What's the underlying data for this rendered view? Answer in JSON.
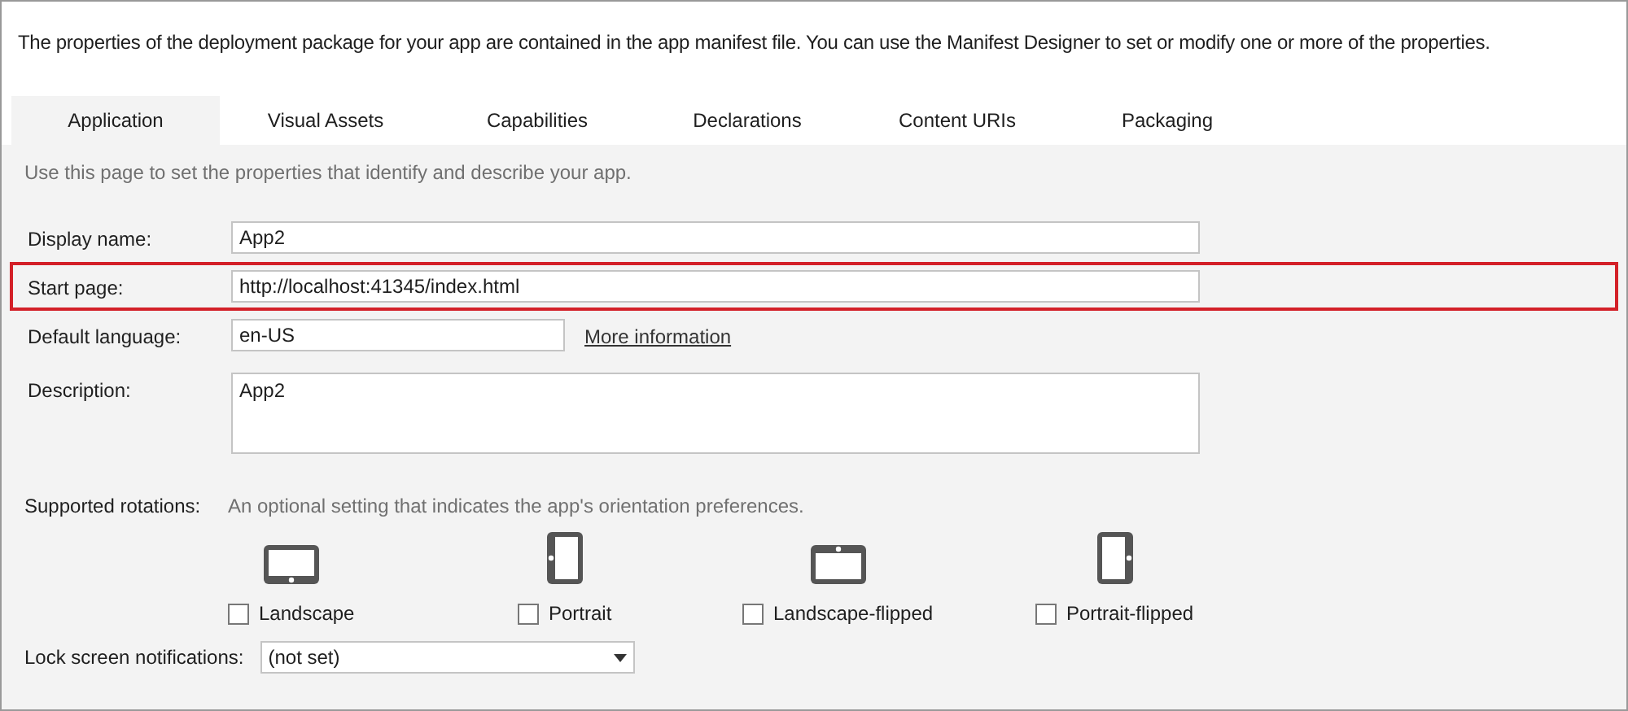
{
  "intro": "The properties of the deployment package for your app are contained in the app manifest file. You can use the Manifest Designer to set or modify one or more of the properties.",
  "tabs": [
    {
      "label": "Application",
      "selected": true
    },
    {
      "label": "Visual Assets",
      "selected": false
    },
    {
      "label": "Capabilities",
      "selected": false
    },
    {
      "label": "Declarations",
      "selected": false
    },
    {
      "label": "Content URIs",
      "selected": false
    },
    {
      "label": "Packaging",
      "selected": false
    }
  ],
  "page_hint": "Use this page to set the properties that identify and describe your app.",
  "fields": [
    {
      "kind": "text",
      "label": "Display name:",
      "value": "App2",
      "highlighted": false
    },
    {
      "kind": "text",
      "label": "Start page:",
      "value": "http://localhost:41345/index.html",
      "highlighted": true
    },
    {
      "kind": "short",
      "label": "Default language:",
      "value": "en-US",
      "link": "More information",
      "highlighted": false
    },
    {
      "kind": "multiline",
      "label": "Description:",
      "value": "App2",
      "highlighted": false
    }
  ],
  "rotations": {
    "label": "Supported rotations:",
    "hint": "An optional setting that indicates the app's orientation preferences.",
    "items": [
      {
        "kind": "landscape",
        "label": "Landscape",
        "checked": false
      },
      {
        "kind": "portrait",
        "label": "Portrait",
        "checked": false
      },
      {
        "kind": "landscape-flipped",
        "label": "Landscape-flipped",
        "checked": false
      },
      {
        "kind": "portrait-flipped",
        "label": "Portrait-flipped",
        "checked": false
      }
    ]
  },
  "lock_screen": {
    "label": "Lock screen notifications:",
    "value": "(not set)"
  }
}
